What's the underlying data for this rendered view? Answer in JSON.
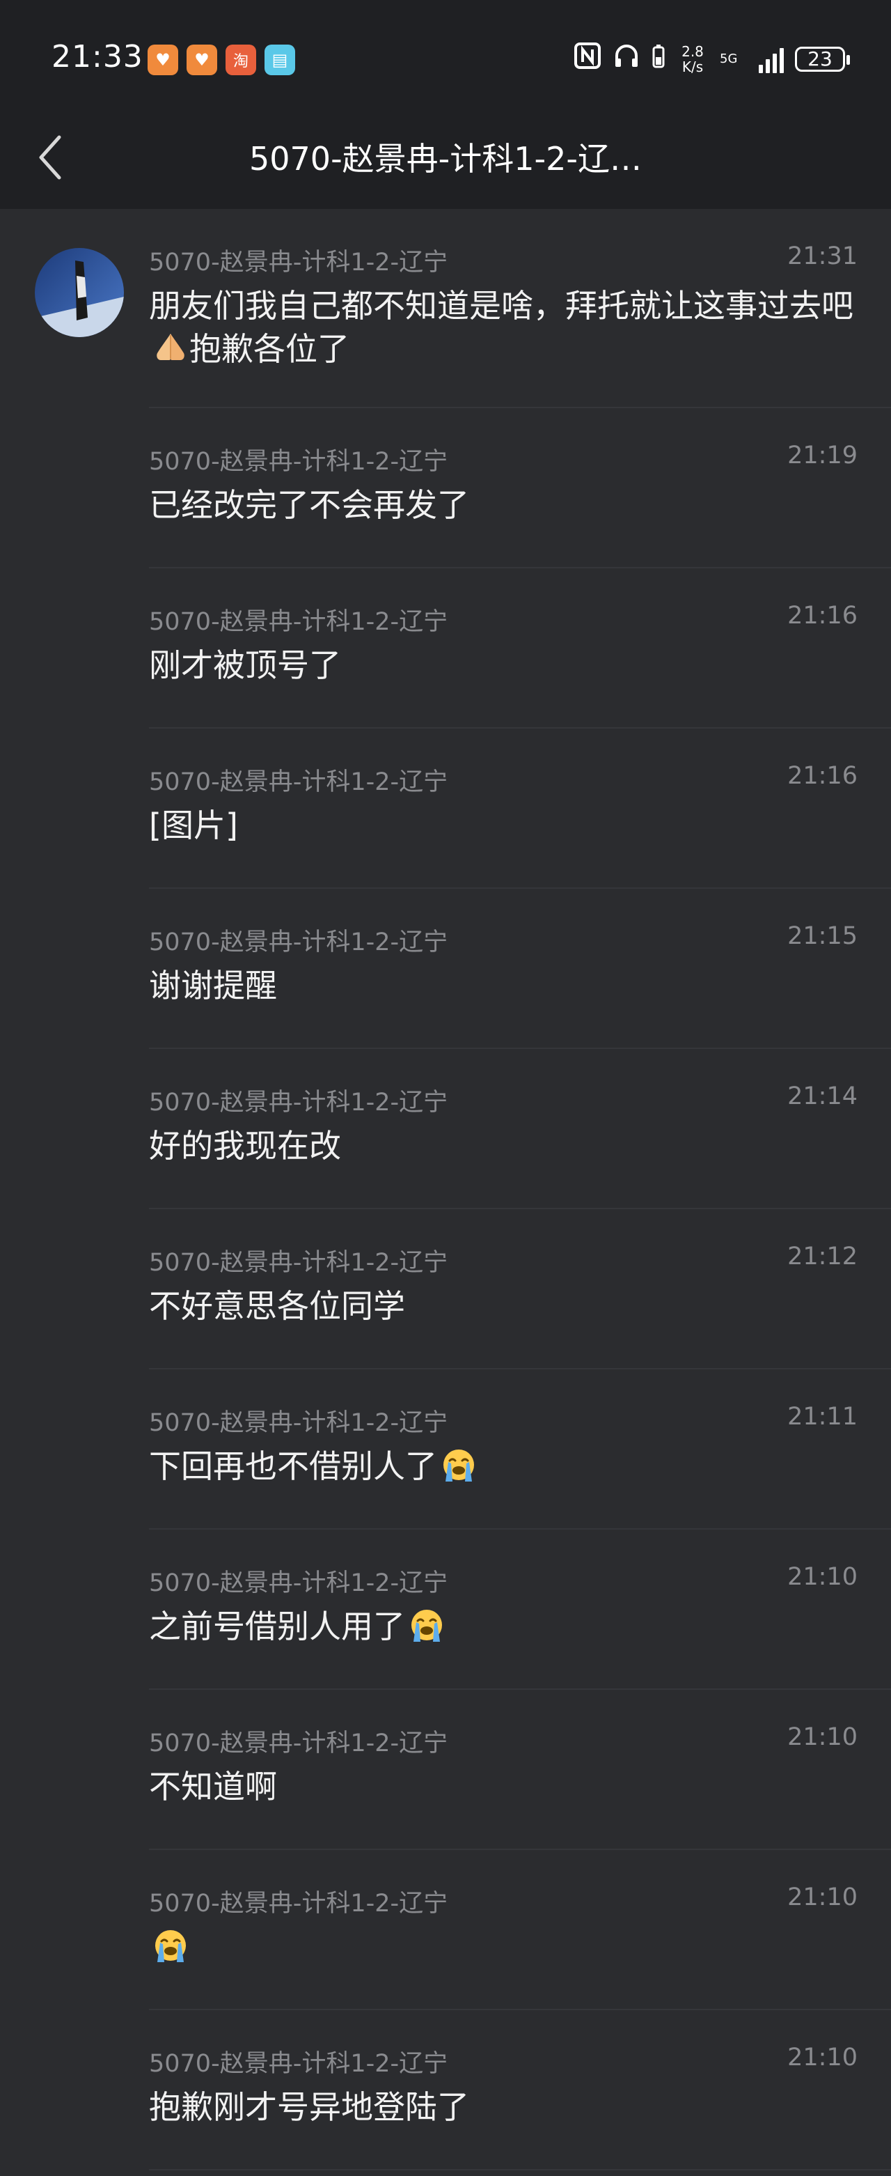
{
  "status_bar": {
    "time": "21:33",
    "app_icons": [
      "taobao-heart-icon",
      "taobao-heart-icon",
      "taobao-icon",
      "book-icon"
    ],
    "app_icon_glyphs": [
      "♥",
      "♥",
      "淘",
      "▤"
    ],
    "net_speed_value": "2.8",
    "net_speed_unit": "K/s",
    "net_type": "5G",
    "battery_level": "23"
  },
  "nav": {
    "title": "5070-赵景冉-计科1-2-辽…"
  },
  "messages": [
    {
      "sender": "5070-赵景冉-计科1-2-辽宁",
      "time": "21:31",
      "text": "朋友们我自己都不知道是啥，拜托就让这事过去吧",
      "text_after": "抱歉各位了",
      "emoji": "folded-hands-emoji",
      "show_avatar": true
    },
    {
      "sender": "5070-赵景冉-计科1-2-辽宁",
      "time": "21:19",
      "text": "已经改完了不会再发了"
    },
    {
      "sender": "5070-赵景冉-计科1-2-辽宁",
      "time": "21:16",
      "text": "刚才被顶号了"
    },
    {
      "sender": "5070-赵景冉-计科1-2-辽宁",
      "time": "21:16",
      "text": "[图片]"
    },
    {
      "sender": "5070-赵景冉-计科1-2-辽宁",
      "time": "21:15",
      "text": "谢谢提醒"
    },
    {
      "sender": "5070-赵景冉-计科1-2-辽宁",
      "time": "21:14",
      "text": "好的我现在改"
    },
    {
      "sender": "5070-赵景冉-计科1-2-辽宁",
      "time": "21:12",
      "text": "不好意思各位同学"
    },
    {
      "sender": "5070-赵景冉-计科1-2-辽宁",
      "time": "21:11",
      "text": "下回再也不借别人了",
      "emoji": "loudly-crying-emoji"
    },
    {
      "sender": "5070-赵景冉-计科1-2-辽宁",
      "time": "21:10",
      "text": "之前号借别人用了",
      "emoji": "loudly-crying-emoji"
    },
    {
      "sender": "5070-赵景冉-计科1-2-辽宁",
      "time": "21:10",
      "text": "不知道啊"
    },
    {
      "sender": "5070-赵景冉-计科1-2-辽宁",
      "time": "21:10",
      "text": "",
      "emoji": "loudly-crying-emoji"
    },
    {
      "sender": "5070-赵景冉-计科1-2-辽宁",
      "time": "21:10",
      "text": "抱歉刚才号异地登陆了"
    }
  ]
}
